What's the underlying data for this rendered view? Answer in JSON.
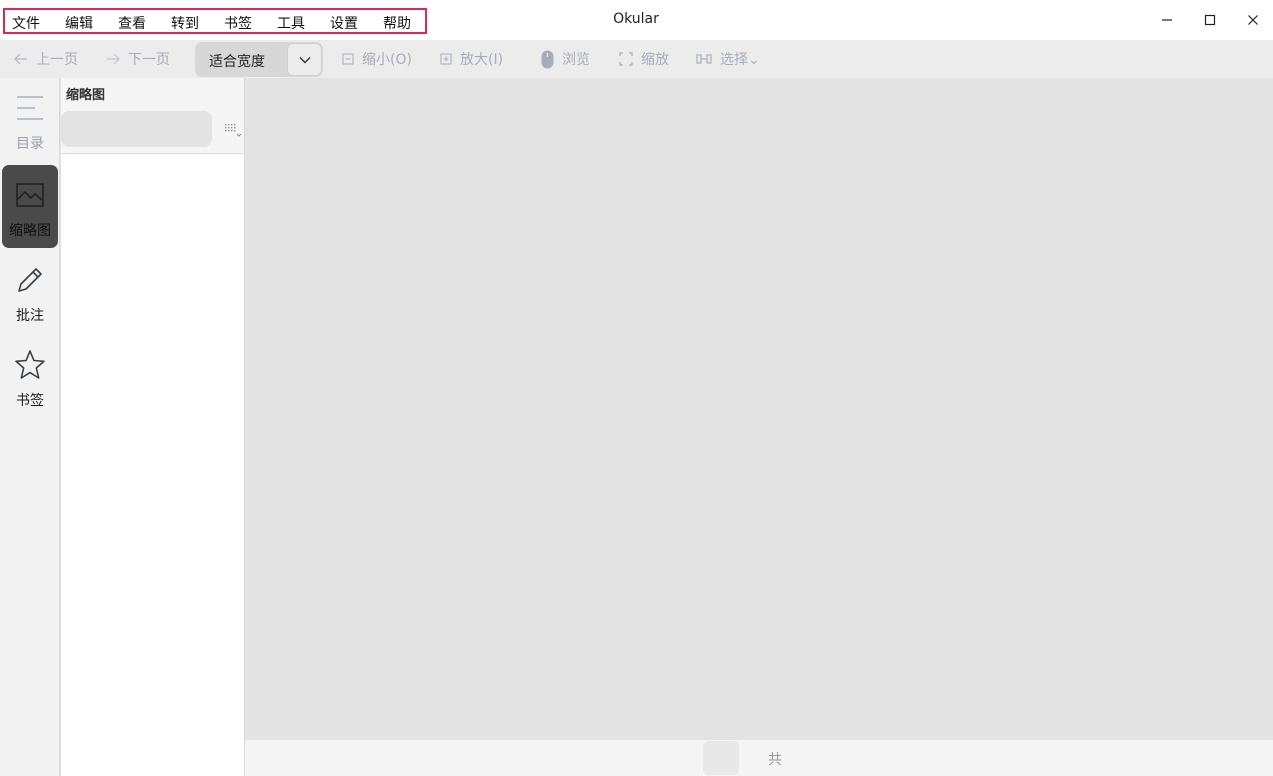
{
  "window": {
    "title": "Okular"
  },
  "menu": {
    "items": [
      "文件",
      "编辑",
      "查看",
      "转到",
      "书签",
      "工具",
      "设置",
      "帮助"
    ],
    "highlight_color": "#e0245e"
  },
  "toolbar": {
    "prev_page": "上一页",
    "next_page": "下一页",
    "zoom_value": "适合宽度",
    "zoom_out": "缩小(O)",
    "zoom_in": "放大(I)",
    "browse": "浏览",
    "zoom_tool": "缩放",
    "select": "选择⌄"
  },
  "sidebar": {
    "tabs": [
      {
        "label": "目录",
        "icon": "contents-icon",
        "active": false
      },
      {
        "label": "缩略图",
        "icon": "thumbnail-image-icon",
        "active": true
      },
      {
        "label": "批注",
        "icon": "pencil-icon",
        "active": false
      },
      {
        "label": "书签",
        "icon": "star-icon",
        "active": false
      }
    ]
  },
  "panel": {
    "title": "缩略图",
    "search_value": ""
  },
  "bottombar": {
    "page_value": "",
    "total_label": "共"
  },
  "colors": {
    "active_tab_bg": "#4a4a4a",
    "disabled_text": "#a6adb8",
    "view_bg": "#e3e3e3"
  }
}
